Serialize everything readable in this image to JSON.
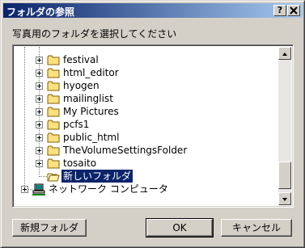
{
  "window": {
    "title": "フォルダの参照",
    "help_label": "?",
    "close_label": "×"
  },
  "prompt": "写真用のフォルダを選択してください",
  "tree": {
    "items": [
      {
        "label": "festival",
        "icon": "folder-icon",
        "selected": false
      },
      {
        "label": "html_editor",
        "icon": "folder-icon",
        "selected": false
      },
      {
        "label": "hyogen",
        "icon": "folder-icon",
        "selected": false
      },
      {
        "label": "mailinglist",
        "icon": "folder-icon",
        "selected": false
      },
      {
        "label": "My Pictures",
        "icon": "folder-icon",
        "selected": false
      },
      {
        "label": "pcfs1",
        "icon": "folder-icon",
        "selected": false
      },
      {
        "label": "public_html",
        "icon": "folder-icon",
        "selected": false
      },
      {
        "label": "TheVolumeSettingsFolder",
        "icon": "folder-icon",
        "selected": false
      },
      {
        "label": "tosaito",
        "icon": "folder-icon",
        "selected": false
      },
      {
        "label": "新しいフォルダ",
        "icon": "folder-open-icon",
        "selected": true
      },
      {
        "label": "ネットワーク コンピュータ",
        "icon": "network-computer-icon",
        "selected": false
      }
    ]
  },
  "buttons": {
    "new_folder": "新規フォルダ",
    "ok": "OK",
    "cancel": "キャンセル"
  },
  "colors": {
    "titlebar_start": "#0a246a",
    "titlebar_end": "#a6caf0",
    "face": "#d4d0c8",
    "selection": "#0a246a"
  }
}
